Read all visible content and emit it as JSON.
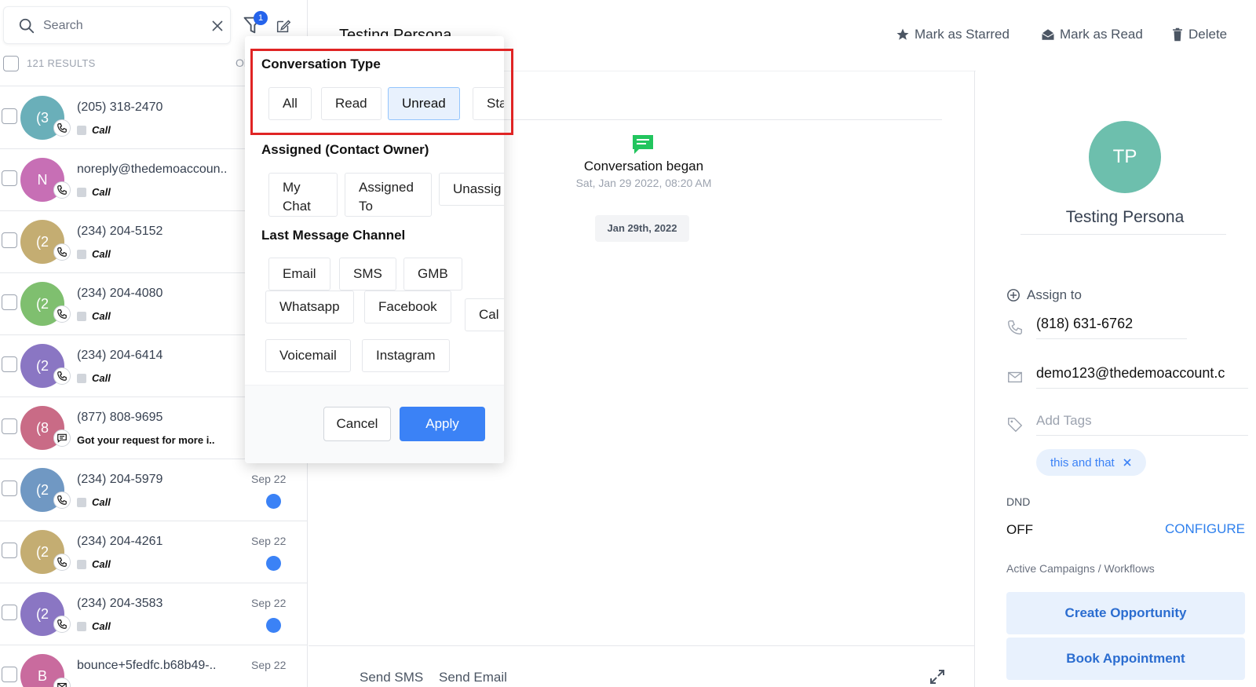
{
  "left_panel": {
    "search_placeholder": "Search",
    "filter_badge": "1",
    "results_label": "121 RESULTS",
    "results_cut": "Ol",
    "conversations": [
      {
        "initial": "(3",
        "color": "#6aafb9",
        "name": "(205) 318-2470",
        "preview": "Call",
        "channel": "phone",
        "date": "",
        "unread": false
      },
      {
        "initial": "N",
        "color": "#c76fb5",
        "name": "noreply@thedemoaccoun..",
        "preview": "Call",
        "channel": "phone",
        "date": "",
        "unread": false
      },
      {
        "initial": "(2",
        "color": "#c4ad72",
        "name": "(234) 204-5152",
        "preview": "Call",
        "channel": "phone",
        "date": "",
        "unread": false
      },
      {
        "initial": "(2",
        "color": "#7fbf6f",
        "name": "(234) 204-4080",
        "preview": "Call",
        "channel": "phone",
        "date": "",
        "unread": false
      },
      {
        "initial": "(2",
        "color": "#8a76c3",
        "name": "(234) 204-6414",
        "preview": "Call",
        "channel": "phone",
        "date": "",
        "unread": false
      },
      {
        "initial": "(8",
        "color": "#c96b86",
        "name": "(877) 808-9695",
        "preview": "Got your request for more i..",
        "channel": "sms",
        "date": "",
        "unread": false
      },
      {
        "initial": "(2",
        "color": "#7098c3",
        "name": "(234) 204-5979",
        "preview": "Call",
        "channel": "phone",
        "date": "Sep 22",
        "unread": true
      },
      {
        "initial": "(2",
        "color": "#c4ad72",
        "name": "(234) 204-4261",
        "preview": "Call",
        "channel": "phone",
        "date": "Sep 22",
        "unread": true
      },
      {
        "initial": "(2",
        "color": "#8a76c3",
        "name": "(234) 204-3583",
        "preview": "Call",
        "channel": "phone",
        "date": "Sep 22",
        "unread": true
      },
      {
        "initial": "B",
        "color": "#c96b9e",
        "name": "bounce+5fedfc.b68b49-..",
        "preview": "",
        "channel": "email",
        "date": "Sep 22",
        "unread": false
      }
    ]
  },
  "header": {
    "title": "Testing Persona",
    "actions": {
      "star": "Mark as Starred",
      "read": "Mark as Read",
      "delete": "Delete"
    }
  },
  "conversation": {
    "began": "Conversation began",
    "began_date": "Sat, Jan 29 2022, 08:20 AM",
    "date_pill": "Jan 29th, 2022",
    "send_sms": "Send SMS",
    "send_email": "Send Email"
  },
  "contact": {
    "initials": "TP",
    "name": "Testing Persona",
    "assign": "Assign to",
    "phone": "(818) 631-6762",
    "email": "demo123@thedemoaccount.c",
    "tags_placeholder": "Add Tags",
    "tag": "this and that",
    "dnd_label": "DND",
    "dnd_value": "OFF",
    "configure": "CONFIGURE",
    "campaigns": "Active Campaigns / Workflows",
    "create_opportunity": "Create Opportunity",
    "book_appointment": "Book Appointment"
  },
  "filter": {
    "conversation_type": {
      "title": "Conversation Type",
      "options": [
        "All",
        "Read",
        "Unread",
        "Sta"
      ],
      "selected": "Unread"
    },
    "assigned": {
      "title": "Assigned (Contact Owner)",
      "opt_my_1": "My",
      "opt_my_2": "Chat",
      "opt_assigned_1": "Assigned",
      "opt_assigned_2": "To",
      "opt_unassigned": "Unassig"
    },
    "channel": {
      "title": "Last Message Channel",
      "options": [
        "Email",
        "SMS",
        "GMB",
        "Whatsapp",
        "Facebook",
        "Cal",
        "Voicemail",
        "Instagram"
      ]
    },
    "cancel": "Cancel",
    "apply": "Apply"
  },
  "colors": {
    "accent": "#3b82f6",
    "highlight": "#e02424",
    "chat_icon": "#22c55e"
  }
}
